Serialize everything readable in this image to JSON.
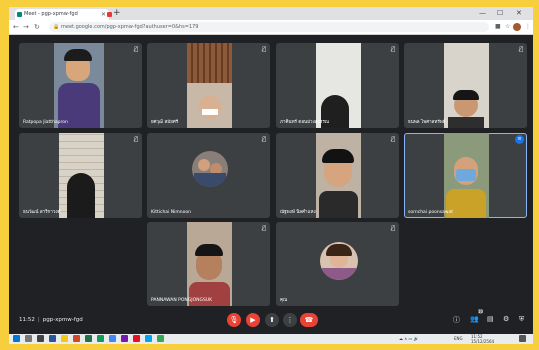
{
  "browser": {
    "tab_title": "Meet - pgp-xpmw-fgd",
    "url": "meet.google.com/pgp-xpmw-fgd?authuser=0&hs=179"
  },
  "participants": [
    {
      "name": "Ratpopa Jiatthapron",
      "muted": true,
      "speaking": false
    },
    {
      "name": "ยศวุฒิ สมัยศรี",
      "muted": true,
      "speaking": false
    },
    {
      "name": "ภาคินทร์ ดอนม่วงสุวรรณ",
      "muted": true,
      "speaking": false
    },
    {
      "name": "ธนพล ไพศาลทรัพย์",
      "muted": true,
      "speaking": false
    },
    {
      "name": "ธนวัฒน์ สาริกาวงศ์",
      "muted": true,
      "speaking": false
    },
    {
      "name": "Kittichai Nimnoon",
      "muted": true,
      "speaking": false
    },
    {
      "name": "ณัฐพงษ์ นิลคำแหง",
      "muted": true,
      "speaking": false
    },
    {
      "name": "sornchai poonsawat",
      "muted": false,
      "speaking": true
    },
    {
      "name": "PANNAWAN PONGJONGSUK",
      "muted": true,
      "speaking": false
    },
    {
      "name": "คุณ",
      "muted": true,
      "speaking": false
    }
  ],
  "meeting": {
    "time": "11:52",
    "code": "pgp-xpmw-fgd",
    "participant_count": "10"
  },
  "controls": {
    "mic_icon": "mic-off-icon",
    "camera_icon": "camera-off-icon",
    "present_icon": "present-icon",
    "more_icon": "more-vert-icon",
    "end_icon": "end-call-icon"
  },
  "taskbar": {
    "clock_time": "11:52",
    "clock_date": "15/12/2564",
    "lang": "ENG"
  },
  "colors": {
    "background": "#202124",
    "tile": "#3c4043",
    "end_call": "#ea4335",
    "speaking_outline": "#8ab4f8",
    "frame": "#f7cf3d"
  }
}
